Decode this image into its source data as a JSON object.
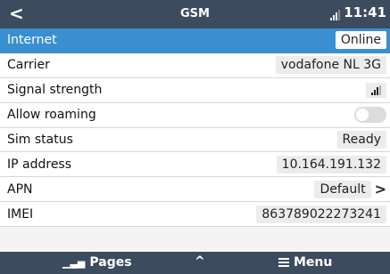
{
  "header": {
    "back": "<",
    "title": "GSM",
    "time": "11:41"
  },
  "rows": [
    {
      "label": "Internet",
      "value": "Online"
    },
    {
      "label": "Carrier",
      "value": "vodafone NL 3G"
    },
    {
      "label": "Signal strength"
    },
    {
      "label": "Allow roaming",
      "toggle_on": false
    },
    {
      "label": "Sim status",
      "value": "Ready"
    },
    {
      "label": "IP address",
      "value": "10.164.191.132"
    },
    {
      "label": "APN",
      "value": "Default",
      "chevron": ">"
    },
    {
      "label": "IMEI",
      "value": "863789022273241"
    }
  ],
  "footer": {
    "pages": "Pages",
    "up": "^",
    "menu": "Menu"
  },
  "icons": [
    "back-icon",
    "signal-icon",
    "toggle-switch",
    "chevron-right-icon",
    "pages-icon",
    "chevron-up-icon",
    "menu-icon"
  ],
  "colors": {
    "bar": "#3c4b5e",
    "selected": "#3a8fd1"
  }
}
